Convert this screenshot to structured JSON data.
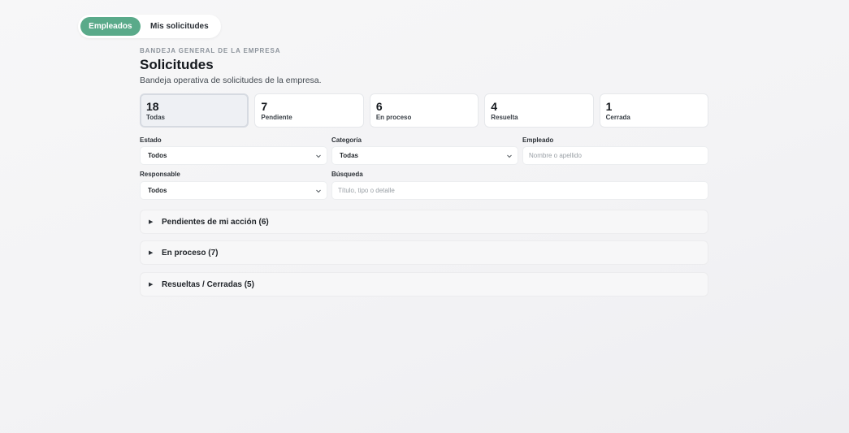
{
  "tabs": {
    "employees": "Empleados",
    "my_requests": "Mis solicitudes"
  },
  "header": {
    "eyebrow": "BANDEJA GENERAL DE LA EMPRESA",
    "title": "Solicitudes",
    "subtitle": "Bandeja operativa de solicitudes de la empresa."
  },
  "stats": [
    {
      "count": "18",
      "label": "Todas"
    },
    {
      "count": "7",
      "label": "Pendiente"
    },
    {
      "count": "6",
      "label": "En proceso"
    },
    {
      "count": "4",
      "label": "Resuelta"
    },
    {
      "count": "1",
      "label": "Cerrada"
    }
  ],
  "filters": {
    "estado": {
      "label": "Estado",
      "value": "Todos"
    },
    "categoria": {
      "label": "Categoría",
      "value": "Todas"
    },
    "empleado": {
      "label": "Empleado",
      "placeholder": "Nombre o apellido"
    },
    "responsable": {
      "label": "Responsable",
      "value": "Todos"
    },
    "busqueda": {
      "label": "Búsqueda",
      "placeholder": "Título, tipo o detalle"
    }
  },
  "sections": [
    {
      "title": "Pendientes de mi acción (6)"
    },
    {
      "title": "En proceso (7)"
    },
    {
      "title": "Resueltas / Cerradas (5)"
    }
  ],
  "colors": {
    "accent": "#5aaa8a",
    "background": "#f4f4f6"
  }
}
